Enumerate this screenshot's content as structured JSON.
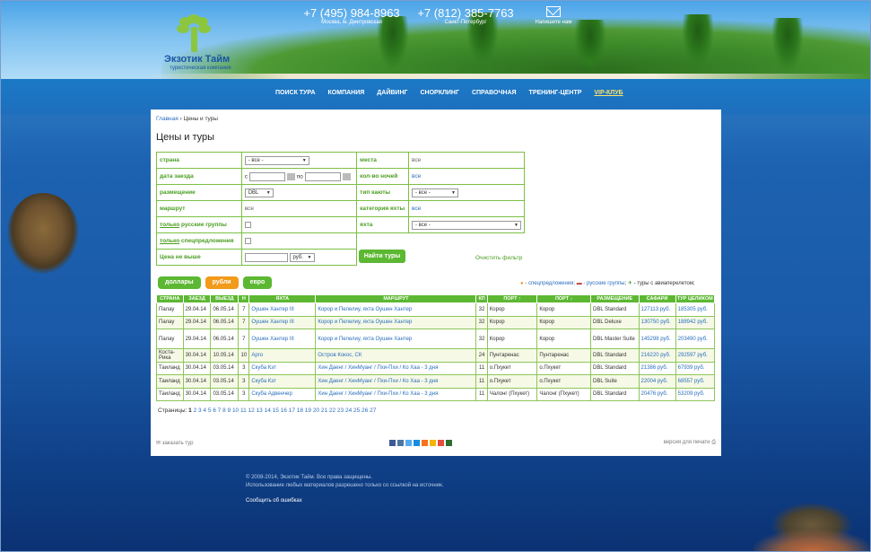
{
  "header": {
    "logo_title": "Экзотик Тайм",
    "logo_subtitle": "туристическая компания",
    "phones": [
      {
        "number": "+7 (495) 984-8963",
        "city": "Москва, м. Дмитровская"
      },
      {
        "number": "+7 (812) 385-7763",
        "city": "Санкт-Петербург"
      }
    ],
    "mail_label": "Напишите нам"
  },
  "nav": [
    "ПОИСК ТУРА",
    "КОМПАНИЯ",
    "ДАЙВИНГ",
    "СНОРКЛИНГ",
    "СПРАВОЧНАЯ",
    "ТРЕНИНГ-ЦЕНТР",
    "VIP-КЛУБ"
  ],
  "breadcrumb": {
    "home": "Главная",
    "sep": " › ",
    "current": "Цены и туры"
  },
  "page_title": "Цены и туры",
  "filter": {
    "country_label": "страна",
    "country_value": "- все -",
    "date_label": "дата заезда",
    "date_from": "с",
    "date_to": "по",
    "placement_label": "размещение",
    "placement_value": "DBL",
    "route_label": "маршрут",
    "route_value": "все",
    "russian_prefix": "только",
    "russian_label": " русские группы",
    "special_prefix": "только",
    "special_label": " спецпредложения",
    "price_label": "Цена не выше",
    "price_currency": "руб.",
    "places_label": "места",
    "places_value": "все",
    "nights_label": "кол-во ночей",
    "nights_value": "все",
    "cabin_label": "тип каюты",
    "cabin_value": "- все -",
    "yacht_cat_label": "категория яхты",
    "yacht_cat_value": "все",
    "yacht_label": "яхта",
    "yacht_value": "- все -",
    "find_button": "Найти туры",
    "clear_filter": "Очистить фильтр"
  },
  "currency_buttons": {
    "usd": "доллары",
    "rub": "рубли",
    "eur": "евро"
  },
  "legend": {
    "special": " - спецпредложения;",
    "russian": " - русские группы",
    "flight": " - туры с авиаперелетом;"
  },
  "table": {
    "headers": [
      "СТРАНА",
      "ЗАЕЗД",
      "ВЫЕЗД",
      "Н",
      "ЯХТА",
      "МАРШРУТ",
      "КП",
      "ПОРТ ↑",
      "ПОРТ ↓",
      "РАЗМЕЩЕНИЕ",
      "САФАРИ",
      "ТУР ЦЕЛИКОМ"
    ],
    "rows": [
      [
        "Палау",
        "29.04.14",
        "06.05.14",
        "7",
        "Оушен Хантер III",
        "Корор и Пелелиу, яхта Оушен Хантер",
        "32",
        "Корор",
        "Корор",
        "DBL Standard",
        "127113 руб.",
        "185305 руб."
      ],
      [
        "Палау",
        "29.04.14",
        "06.05.14",
        "7",
        "Оушен Хантер III",
        "Корор и Пелелиу, яхта Оушен Хантер",
        "32",
        "Корор",
        "Корор",
        "DBL Deluxe",
        "130750 руб.",
        "188942 руб."
      ],
      [
        "Палау",
        "29.04.14",
        "06.05.14",
        "7",
        "Оушен Хантер III",
        "Корор и Пелелиу, яхта Оушен Хантер",
        "32",
        "Корор",
        "Корор",
        "DBL Master Suite",
        "145298 руб.",
        "203490 руб."
      ],
      [
        "Коста-Рика",
        "30.04.14",
        "10.05.14",
        "10",
        "Арго",
        "Остров Кокос, СК",
        "24",
        "Пунтаренас",
        "Пунтаренас",
        "DBL Standard",
        "216220 руб.",
        "292597 руб."
      ],
      [
        "Таиланд",
        "30.04.14",
        "03.05.14",
        "3",
        "Скуба Кэт",
        "Хин Даенг / ХинМуанг / Пхи-Пхи / Ко Хаа - 3 дня",
        "11",
        "о.Пхукет",
        "о.Пхукет",
        "DBL Standard",
        "21386 руб.",
        "67939 руб."
      ],
      [
        "Таиланд",
        "30.04.14",
        "03.05.14",
        "3",
        "Скуба Кэт",
        "Хин Даенг / ХинМуанг / Пхи-Пхи / Ко Хаа - 3 дня",
        "11",
        "о.Пхукет",
        "о.Пхукет",
        "DBL Suite",
        "22004 руб.",
        "68557 руб."
      ],
      [
        "Таиланд",
        "30.04.14",
        "03.05.14",
        "3",
        "Скуба Адвенчер",
        "Хин Даенг / ХинМуанг / Пхи-Пхи / Ко Хаа - 3 дня",
        "11",
        "Чалонг (Пхукет)",
        "Чалонг (Пхукет)",
        "DBL Standard",
        "20476 руб.",
        "53209 руб."
      ]
    ]
  },
  "pagination": {
    "label": "Страницы:",
    "current": "1",
    "others": "2 3 4 5 6 7 8 9 10 11 12 13 14 15 16 17 18 19 20 21 22 23 24 25 26 27"
  },
  "bottom": {
    "order": "заказать тур",
    "print": "версия для печати"
  },
  "footer": {
    "copyright": "© 2008-2014, Экзотик Тайм. Все права защищены.",
    "note": "Использование любых материалов разрешено только со ссылкой на источник.",
    "report": "Сообщить об ошибках"
  },
  "colors": {
    "green": "#5cb832",
    "orange": "#f29a1a",
    "link": "#2a6ebd"
  }
}
